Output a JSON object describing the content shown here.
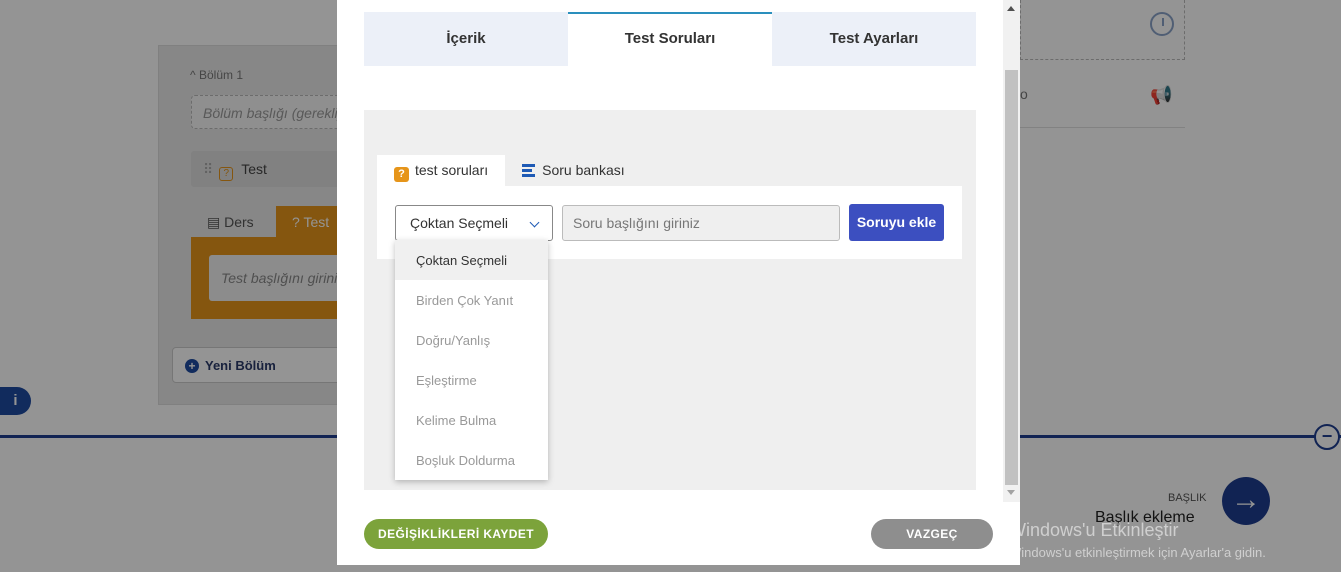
{
  "background": {
    "section_label": "Bölüm 1",
    "section_title_placeholder": "Bölüm başlığı (gerekli)",
    "test_item_label": "Test",
    "lesson_tab_label": "Ders",
    "test_tab_label": "Test",
    "test_title_placeholder": "Test başlığını giriniz",
    "new_section_button": "Yeni Bölüm",
    "info_glyph": "i",
    "right_row_text": "o",
    "heading_small": "BAŞLIK",
    "heading_big": "Başlık ekleme"
  },
  "modal": {
    "tabs": [
      {
        "label": "İçerik",
        "active": false
      },
      {
        "label": "Test Soruları",
        "active": true
      },
      {
        "label": "Test Ayarları",
        "active": false
      }
    ],
    "subtabs": [
      {
        "label": "test soruları",
        "active": true,
        "icon": "question-icon"
      },
      {
        "label": "Soru bankası",
        "active": false,
        "icon": "list-icon"
      }
    ],
    "question_type": {
      "selected": "Çoktan Seçmeli",
      "options": [
        "Çoktan Seçmeli",
        "Birden Çok Yanıt",
        "Doğru/Yanlış",
        "Eşleştirme",
        "Kelime Bulma",
        "Boşluk Doldurma"
      ]
    },
    "question_input_placeholder": "Soru başlığını giriniz",
    "add_question_button": "Soruyu ekle",
    "save_button": "DEĞİŞİKLİKLERİ KAYDET",
    "cancel_button": "VAZGEÇ"
  },
  "windows_activation": {
    "title": "Windows'u Etkinleştir",
    "subtitle": "Windows'u etkinleştirmek için Ayarlar'a gidin."
  },
  "colors": {
    "accent_blue": "#3c4fc0",
    "tab_active_border": "#2a8fbd",
    "save_green": "#7ca33b",
    "cancel_gray": "#8e8e8e",
    "test_orange": "#e6951a"
  }
}
